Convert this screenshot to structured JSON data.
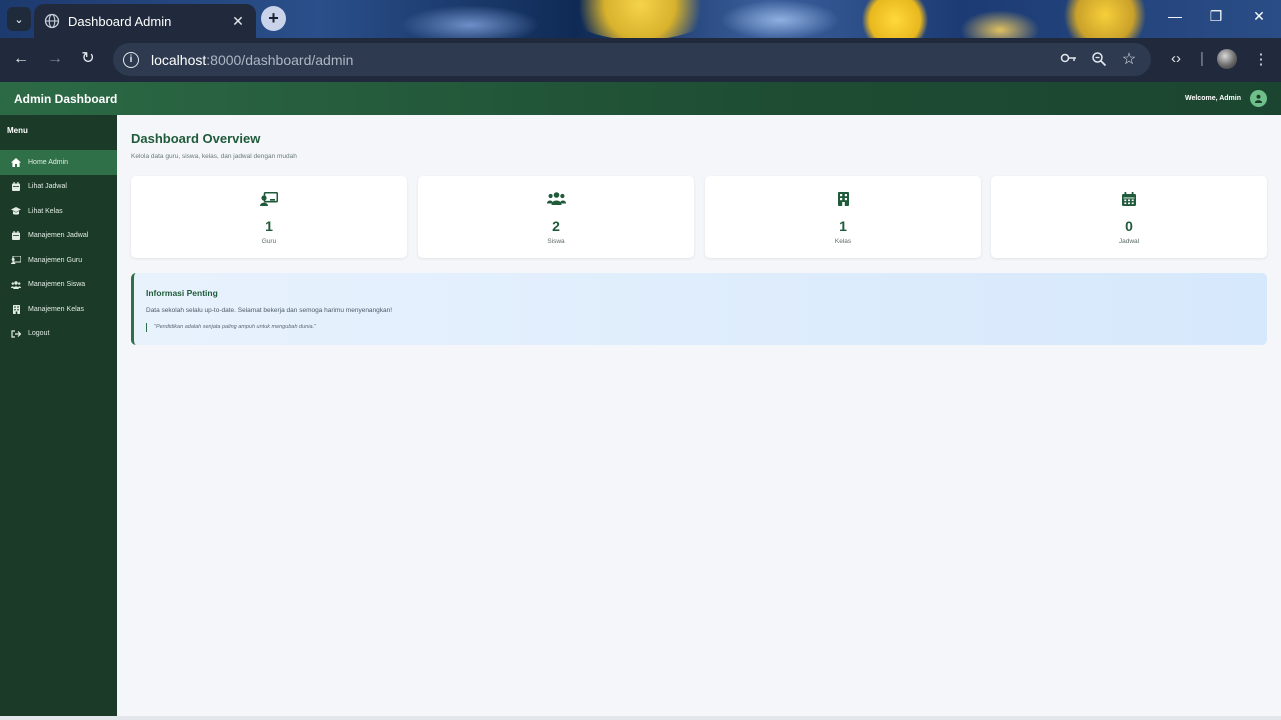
{
  "browser": {
    "tab_title": "Dashboard Admin",
    "url_host": "localhost",
    "url_path": ":8000/dashboard/admin"
  },
  "header": {
    "brand": "Admin Dashboard",
    "welcome": "Welcome, Admin"
  },
  "sidebar": {
    "title": "Menu",
    "items": [
      {
        "label": "Home Admin",
        "icon": "home-icon",
        "active": true
      },
      {
        "label": "Lihat Jadwal",
        "icon": "calendar-icon",
        "active": false
      },
      {
        "label": "Lihat Kelas",
        "icon": "school-icon",
        "active": false
      },
      {
        "label": "Manajemen Jadwal",
        "icon": "calendar-icon",
        "active": false
      },
      {
        "label": "Manajemen Guru",
        "icon": "teacher-icon",
        "active": false
      },
      {
        "label": "Manajemen Siswa",
        "icon": "users-icon",
        "active": false
      },
      {
        "label": "Manajemen Kelas",
        "icon": "building-icon",
        "active": false
      },
      {
        "label": "Logout",
        "icon": "logout-icon",
        "active": false
      }
    ]
  },
  "main": {
    "title": "Dashboard Overview",
    "subtitle": "Kelola data guru, siswa, kelas, dan jadwal dengan mudah",
    "stats": [
      {
        "value": "1",
        "label": "Guru",
        "icon": "teacher-icon"
      },
      {
        "value": "2",
        "label": "Siswa",
        "icon": "users-icon"
      },
      {
        "value": "1",
        "label": "Kelas",
        "icon": "building-icon"
      },
      {
        "value": "0",
        "label": "Jadwal",
        "icon": "calendar-icon"
      }
    ],
    "info": {
      "title": "Informasi Penting",
      "text": "Data sekolah selalu up-to-date. Selamat bekerja dan semoga harimu menyenangkan!",
      "quote": "\"Pendidikan adalah senjata paling ampuh untuk mengubah dunia.\""
    }
  },
  "colors": {
    "primary": "#1f5a3a",
    "sidebar_bg": "#1b3a28",
    "active_item": "#2f7048",
    "page_bg": "#f4f6fa"
  }
}
